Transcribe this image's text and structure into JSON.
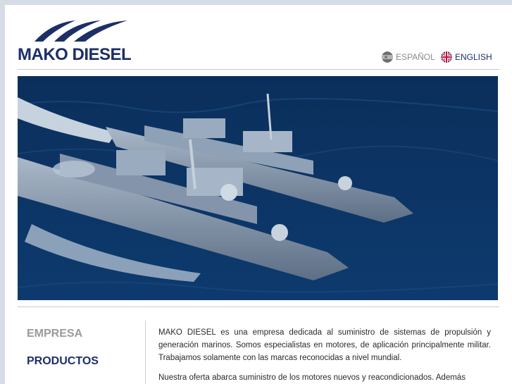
{
  "brand": {
    "name": "MAKO DIESEL",
    "primary_color": "#1d2f66"
  },
  "languages": [
    {
      "label": "ESPAÑOL",
      "icon": "spain-flag-icon",
      "active": false
    },
    {
      "label": "ENGLISH",
      "icon": "uk-flag-icon",
      "active": true
    }
  ],
  "hero": {
    "subject": "two naval frigates at sea"
  },
  "menu": [
    {
      "label": "EMPRESA",
      "active": false
    },
    {
      "label": "PRODUCTOS",
      "active": true
    }
  ],
  "content": {
    "paragraphs": [
      "MAKO DIESEL es una empresa dedicada al suministro de sistemas de propulsión y generación marinos. Somos especialistas en motores, de aplicación principalmente militar. Trabajamos solamente con las marcas reconocidas a nivel mundial.",
      "Nuestra oferta abarca suministro de los motores nuevos y reacondicionados. Además"
    ]
  }
}
